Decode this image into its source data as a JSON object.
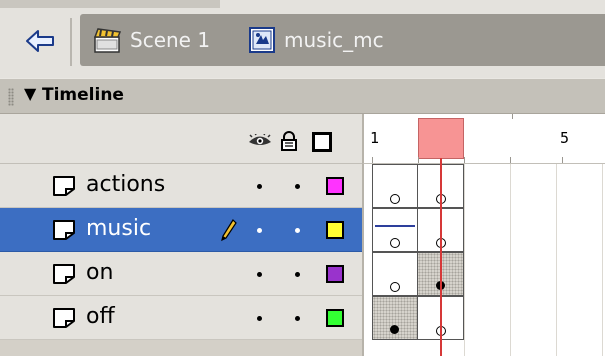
{
  "scene_bar": {
    "back_icon": "back-arrow-icon",
    "breadcrumbs": [
      {
        "label": "Scene 1",
        "icon": "clapperboard-icon"
      },
      {
        "label": "music_mc",
        "icon": "movieclip-symbol-icon"
      }
    ]
  },
  "panel": {
    "title": "Timeline",
    "collapse_icon": "triangle-down-icon"
  },
  "header": {
    "icons": [
      "eye-icon",
      "lock-icon",
      "outline-icon"
    ]
  },
  "ruler": {
    "labels": [
      "1",
      "5"
    ],
    "current_frame": 2
  },
  "layers": [
    {
      "name": "actions",
      "selected": false,
      "editing": false,
      "color": "#ff33ff",
      "frames": [
        {
          "type": "keyframe-empty"
        },
        {
          "type": "keyframe-empty"
        }
      ]
    },
    {
      "name": "music",
      "selected": true,
      "editing": true,
      "color": "#ffff33",
      "frames": [
        {
          "type": "keyframe-empty",
          "sound": true
        },
        {
          "type": "keyframe-empty"
        }
      ]
    },
    {
      "name": "on",
      "selected": false,
      "editing": false,
      "color": "#9933cc",
      "frames": [
        {
          "type": "keyframe-empty"
        },
        {
          "type": "keyframe-filled",
          "shaded": true
        }
      ]
    },
    {
      "name": "off",
      "selected": false,
      "editing": false,
      "color": "#33ff33",
      "frames": [
        {
          "type": "keyframe-filled",
          "shaded": true
        },
        {
          "type": "keyframe-empty"
        }
      ]
    }
  ],
  "colors": {
    "selected_row": "#3c6ec2",
    "playhead": "#f79494",
    "playhead_line": "#d63838"
  }
}
